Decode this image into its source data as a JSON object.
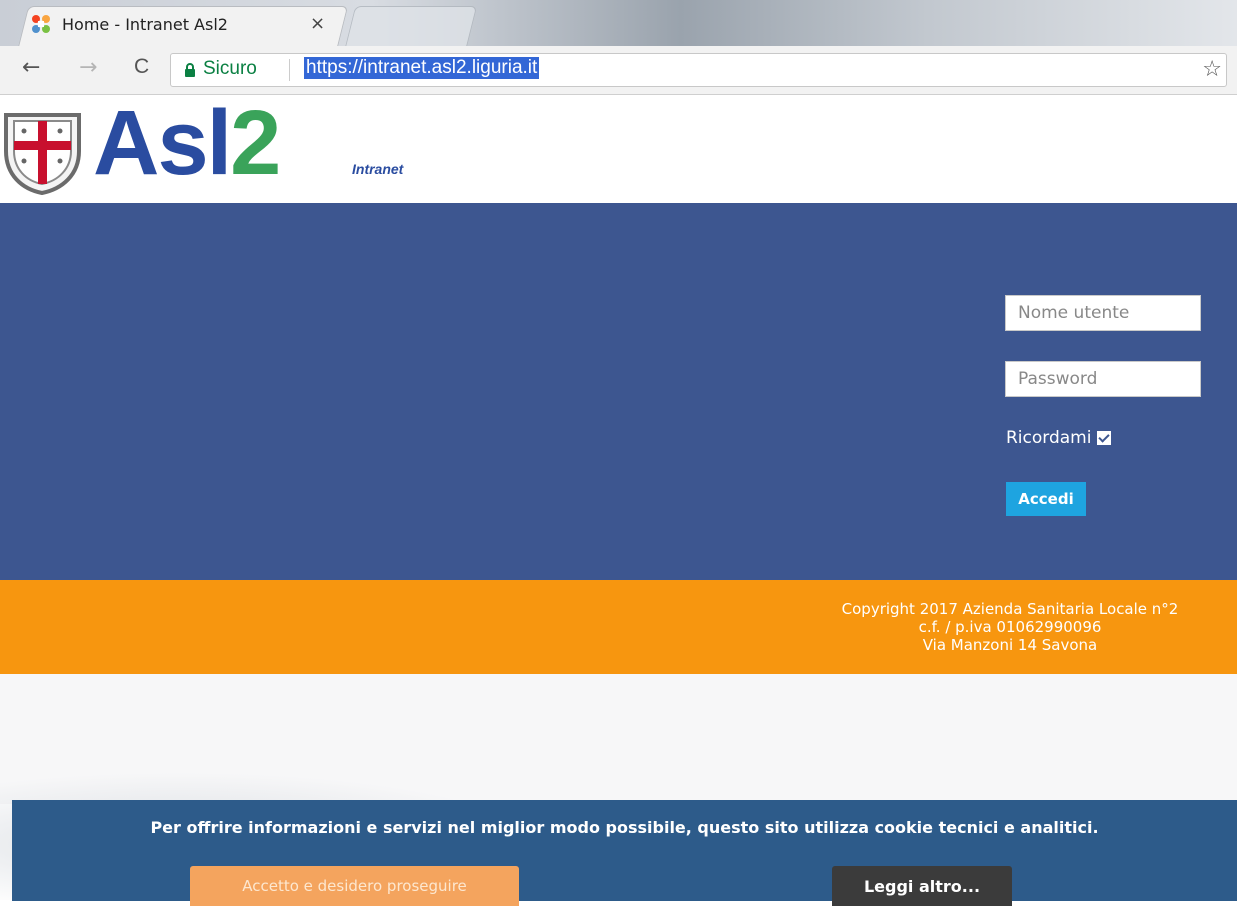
{
  "browser": {
    "tab_title": "Home - Intranet Asl2",
    "tab_close": "×",
    "nav_back": "←",
    "nav_forward": "→",
    "nav_reload": "C",
    "secure_label": "Sicuro",
    "url": "https://intranet.asl2.liguria.it",
    "bookmark_icon": "☆"
  },
  "header": {
    "brand_main": "Asl",
    "brand_number": "2",
    "brand_subtitle": "Intranet",
    "logo_icon": "liguria-crest-icon",
    "colors": {
      "brand_blue": "#2a4ca0",
      "brand_green": "#3aa35a"
    }
  },
  "login": {
    "username_placeholder": "Nome utente",
    "password_placeholder": "Password",
    "remember_label": "Ricordami",
    "remember_checked": true,
    "submit_label": "Accedi",
    "band_color": "#3d5690",
    "button_color": "#1ea4e0"
  },
  "footer": {
    "line1": "Copyright 2017 Azienda Sanitaria Locale n°2",
    "line2": "c.f. / p.iva 01062990096",
    "line3": "Via Manzoni 14 Savona",
    "band_color": "#f7960f"
  },
  "cookie": {
    "message": "Per offrire informazioni e servizi nel miglior modo possibile, questo sito utilizza cookie tecnici e analitici.",
    "accept_label": "Accetto e desidero proseguire",
    "more_label": "Leggi altro..."
  }
}
